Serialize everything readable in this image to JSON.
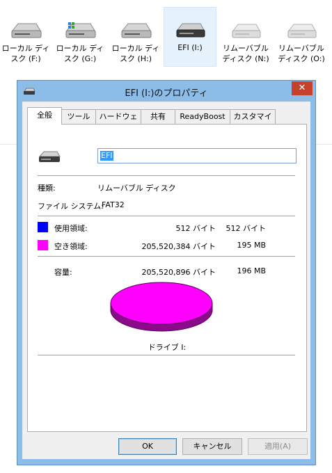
{
  "drives": [
    {
      "label": "ローカル ディ\nスク (F:)",
      "icon": "hard-drive-icon"
    },
    {
      "label": "ローカル ディ\nスク (G:)",
      "icon": "hard-drive-system-icon"
    },
    {
      "label": "ローカル ディ\nスク (H:)",
      "icon": "hard-drive-icon"
    },
    {
      "label": "EFI (I:)",
      "icon": "removable-drive-icon"
    },
    {
      "label": "リムーバブル\nディスク (N:)",
      "icon": "removable-drive-icon"
    },
    {
      "label": "リムーバブル\nディスク (O:)",
      "icon": "removable-drive-icon"
    }
  ],
  "dialog": {
    "title": "EFI (I:)のプロパティ",
    "close_label": "✕",
    "tabs": [
      "全般",
      "ツール",
      "ハードウェア",
      "共有",
      "ReadyBoost",
      "カスタマイズ"
    ],
    "active_tab": "全般",
    "volume_name": "EFI",
    "type_label": "種類:",
    "type_value": "リムーバブル ディスク",
    "fs_label": "ファイル システム:",
    "fs_value": "FAT32",
    "used_label": "使用領域:",
    "used_bytes": "512 バイト",
    "used_short": "512 バイト",
    "free_label": "空き領域:",
    "free_bytes": "205,520,384 バイト",
    "free_short": "195 MB",
    "capacity_label": "容量:",
    "capacity_bytes": "205,520,896 バイト",
    "capacity_short": "196 MB",
    "drive_caption": "ドライブ I:",
    "colors": {
      "used": "#0000ff",
      "free": "#ff00ff",
      "free_side": "#8b0a8b"
    },
    "buttons": {
      "ok": "OK",
      "cancel": "キャンセル",
      "apply": "適用(A)"
    }
  }
}
